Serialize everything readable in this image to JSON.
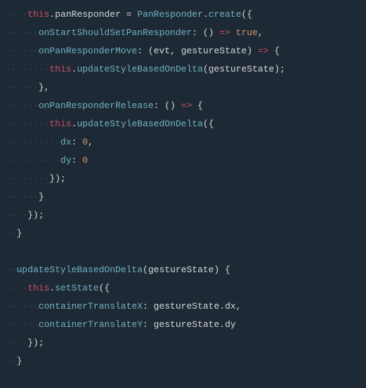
{
  "code": {
    "indent": {
      "d2": "····",
      "d3": "······",
      "d4": "········",
      "d5": "··········",
      "d6": "············"
    },
    "tokens": {
      "this": "this",
      "dot": ".",
      "panResponder": "panResponder",
      "equals": " = ",
      "PanResponder": "PanResponder",
      "create": "create",
      "openParen": "(",
      "closeParen": ")",
      "openBrace": "{",
      "closeBrace": "}",
      "semicolon": ";",
      "comma": ",",
      "colon": ": ",
      "arrow": " => ",
      "arrowFn": "()",
      "true": "true",
      "onStartShouldSetPanResponder": "onStartShouldSetPanResponder",
      "onPanResponderMove": "onPanResponderMove",
      "onPanResponderRelease": "onPanResponderRelease",
      "evt": "evt",
      "gestureState": "gestureState",
      "updateStyleBasedOnDelta": "updateStyleBasedOnDelta",
      "dx": "dx",
      "dy": "dy",
      "zero": "0",
      "setState": "setState",
      "containerTranslateX": "containerTranslateX",
      "containerTranslateY": "containerTranslateY",
      "space": " "
    }
  }
}
